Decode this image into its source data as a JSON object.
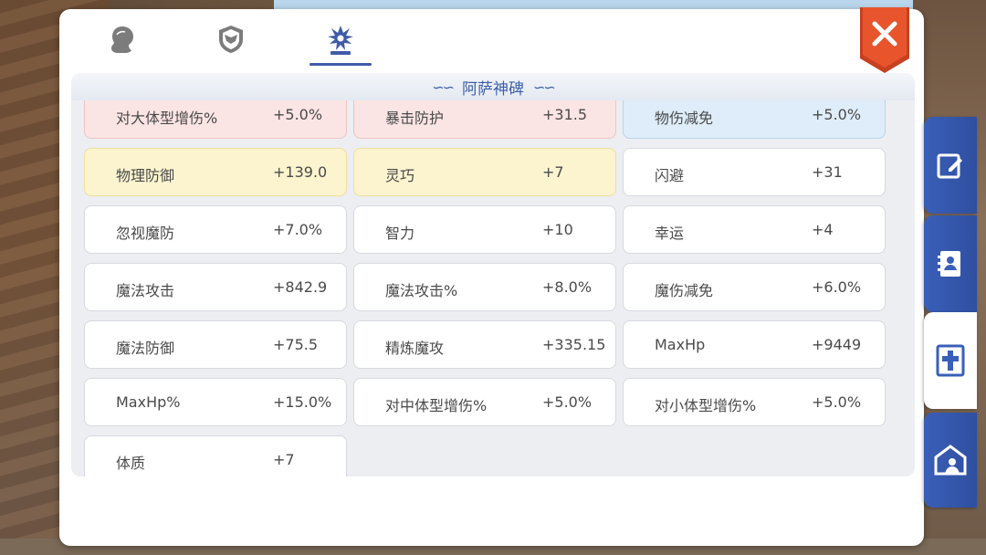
{
  "top_tabs": [
    {
      "icon": "character-silhouette-icon",
      "active": false
    },
    {
      "icon": "shield-emblem-icon",
      "active": false
    },
    {
      "icon": "monument-icon",
      "active": true
    }
  ],
  "section": {
    "title": "阿萨神碑"
  },
  "stats": [
    {
      "label": "对大体型增伤%",
      "value": "+5.0%",
      "tone": "red"
    },
    {
      "label": "暴击防护",
      "value": "+31.5",
      "tone": "red"
    },
    {
      "label": "物伤减免",
      "value": "+5.0%",
      "tone": "blue"
    },
    {
      "label": "物理防御",
      "value": "+139.0",
      "tone": "yellow"
    },
    {
      "label": "灵巧",
      "value": "+7",
      "tone": "yellow"
    },
    {
      "label": "闪避",
      "value": "+31",
      "tone": "white"
    },
    {
      "label": "忽视魔防",
      "value": "+7.0%",
      "tone": "white"
    },
    {
      "label": "智力",
      "value": "+10",
      "tone": "white"
    },
    {
      "label": "幸运",
      "value": "+4",
      "tone": "white"
    },
    {
      "label": "魔法攻击",
      "value": "+842.9",
      "tone": "white"
    },
    {
      "label": "魔法攻击%",
      "value": "+8.0%",
      "tone": "white"
    },
    {
      "label": "魔伤减免",
      "value": "+6.0%",
      "tone": "white"
    },
    {
      "label": "魔法防御",
      "value": "+75.5",
      "tone": "white"
    },
    {
      "label": "精炼魔攻",
      "value": "+335.15",
      "tone": "white"
    },
    {
      "label": "MaxHp",
      "value": "+9449",
      "tone": "white"
    },
    {
      "label": "MaxHp%",
      "value": "+15.0%",
      "tone": "white"
    },
    {
      "label": "对中体型增伤%",
      "value": "+5.0%",
      "tone": "white"
    },
    {
      "label": "对小体型增伤%",
      "value": "+5.0%",
      "tone": "white"
    },
    {
      "label": "体质",
      "value": "+7",
      "tone": "white"
    }
  ],
  "side_tabs": [
    {
      "icon": "edit-note-icon",
      "active": false
    },
    {
      "icon": "contact-book-icon",
      "active": false
    },
    {
      "icon": "monument-cross-icon",
      "active": true
    },
    {
      "icon": "guild-house-icon",
      "active": false
    }
  ],
  "colors": {
    "accent": "#3f5aa8",
    "close": "#e0502a",
    "side_tab": "#3a5fb8"
  }
}
